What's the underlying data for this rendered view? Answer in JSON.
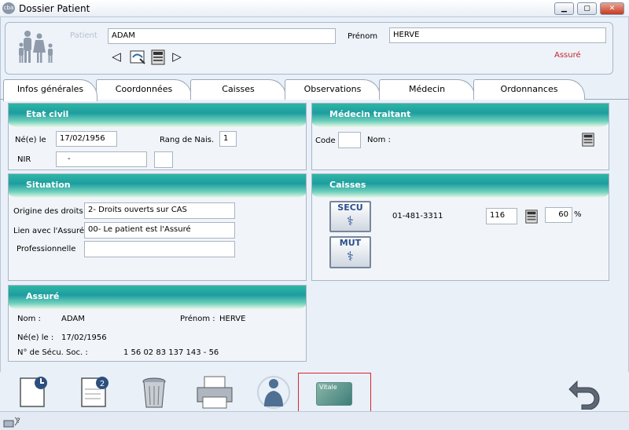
{
  "window": {
    "title": "Dossier Patient",
    "app_icon_text": "cba",
    "min_label": "▁",
    "max_label": "▢",
    "close_label": "✕"
  },
  "patient": {
    "patient_label": "Patient",
    "patient_value": "ADAM",
    "prenom_label": "Prénom",
    "prenom_value": "HERVE",
    "status": "Assuré",
    "status_color": "#c0262b"
  },
  "nav": {
    "prev": "◁",
    "next": "▷"
  },
  "tabs": [
    {
      "label": "Infos générales"
    },
    {
      "label": "Coordonnées"
    },
    {
      "label": "Caisses"
    },
    {
      "label": "Observations"
    },
    {
      "label": "Médecin"
    },
    {
      "label": "Ordonnances"
    }
  ],
  "etat_civil": {
    "title": "Etat civil",
    "ne_le_label": "Né(e) le",
    "ne_le_value": "17/02/1956",
    "rang_label": "Rang de Nais.",
    "rang_value": "1",
    "nir_label": "NIR",
    "nir_value": "-",
    "nir_key_value": ""
  },
  "medecin": {
    "title": "Médecin traitant",
    "code_label": "Code",
    "code_value": "",
    "nom_label": "Nom :"
  },
  "situation": {
    "title": "Situation",
    "origine_label": "Origine des droits",
    "origine_value": "2- Droits ouverts sur CAS",
    "lien_label": "Lien avec l'Assuré",
    "lien_value": "00- Le patient est l'Assuré",
    "prof_label": "Professionnelle",
    "prof_value": ""
  },
  "caisses": {
    "title": "Caisses",
    "secu_label": "SECU",
    "mut_label": "MUT",
    "numero": "01-481-3311",
    "code": "116",
    "taux": "60",
    "pct": "%"
  },
  "assure": {
    "title": "Assuré",
    "nom_label": "Nom :",
    "nom_value": "ADAM",
    "prenom_label": "Prénom :",
    "prenom_value": "HERVE",
    "ne_label": "Né(e) le :",
    "ne_value": "17/02/1956",
    "secu_label": "N° de Sécu. Soc. :",
    "secu_value": "1 56 02 83 137 143 - 56"
  },
  "toolbar": {
    "icons": [
      "new-document-icon",
      "document-2-icon",
      "trash-icon",
      "printer-icon",
      "patient-icon",
      "vitale-card-icon",
      "undo-icon"
    ],
    "vitale_text": "Vitale",
    "highlight_color": "#d9262b"
  }
}
